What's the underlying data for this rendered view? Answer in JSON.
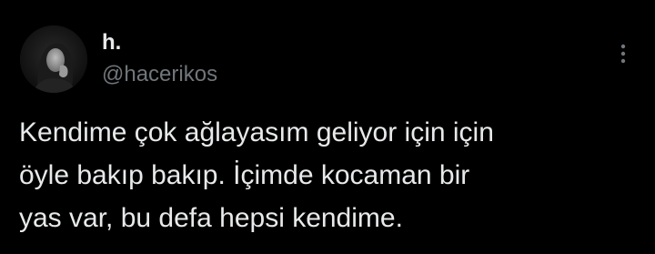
{
  "tweet": {
    "author": {
      "display_name": "h.",
      "handle": "@hacerikos",
      "avatar_icon": "profile-photo-avatar"
    },
    "more_icon": "more-options-vertical-dots-icon",
    "text_lines": [
      "Kendime çok ağlayasım geliyor için için",
      "öyle bakıp bakıp. İçimde kocaman bir",
      "yas var, bu defa hepsi kendime."
    ]
  },
  "colors": {
    "background": "#000000",
    "primary_text": "#e7e9ea",
    "secondary_text": "#71767b"
  }
}
